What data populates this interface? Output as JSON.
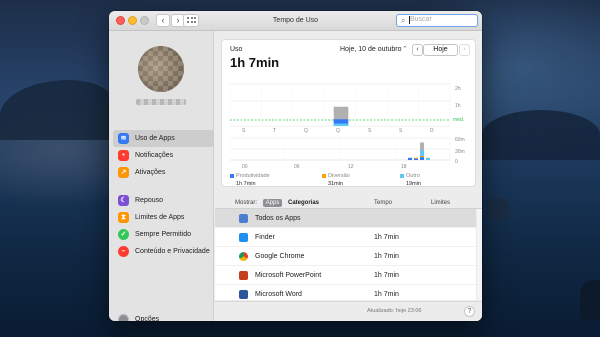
{
  "window": {
    "title": "Tempo de Uso"
  },
  "search": {
    "placeholder": "Buscar"
  },
  "sidebar": {
    "items": [
      {
        "label": "Uso de Apps",
        "icon": "layers-icon",
        "color": "#3478f6",
        "selected": true
      },
      {
        "label": "Notificações",
        "icon": "bell-icon",
        "color": "#ff3b30"
      },
      {
        "label": "Ativações",
        "icon": "pickup-icon",
        "color": "#ff9500"
      },
      {
        "label": "Repouso",
        "icon": "moon-icon",
        "color": "#7d4fd6"
      },
      {
        "label": "Limites de Apps",
        "icon": "hourglass-icon",
        "color": "#ff9500"
      },
      {
        "label": "Sempre Permitido",
        "icon": "checkmark-icon",
        "color": "#34c759"
      },
      {
        "label": "Conteúdo e Privacidade",
        "icon": "no-entry-icon",
        "color": "#ff3b30"
      }
    ],
    "options_label": "Opções"
  },
  "usage": {
    "label": "Uso",
    "total": "1h 7min",
    "date_label": "Hoje, 10 de outubro",
    "today_button": "Hoje",
    "weekly_axis": [
      "2h",
      "1h",
      "méd."
    ],
    "weekday_labels": [
      "S",
      "T",
      "Q",
      "Q",
      "S",
      "S",
      "D"
    ],
    "hourly_axis": [
      "60m",
      "30m",
      "0"
    ],
    "hour_labels": [
      "00",
      "06",
      "12",
      "18"
    ],
    "legend": [
      {
        "name": "Produtividade",
        "value": "1h 7min",
        "color": "#3478f6"
      },
      {
        "name": "Diversão",
        "value": "31min",
        "color": "#ff9f0a"
      },
      {
        "name": "Outro",
        "value": "19min",
        "color": "#5ac8fa"
      }
    ]
  },
  "chart_data": [
    {
      "type": "bar",
      "categories": [
        "S",
        "T",
        "Q",
        "Q",
        "S",
        "S",
        "D"
      ],
      "series": [
        {
          "values": [
            0,
            0,
            0,
            1.1,
            0,
            0,
            0
          ]
        }
      ],
      "ylabels": [
        "2h",
        "1h",
        "méd."
      ],
      "average_line": true
    },
    {
      "type": "bar",
      "categories": [
        "00",
        "06",
        "12",
        "18"
      ],
      "series": [
        {
          "name": "Produtividade",
          "values": [
            0,
            0,
            0,
            20
          ]
        },
        {
          "name": "Diversão",
          "values": [
            0,
            0,
            0,
            5
          ]
        },
        {
          "name": "Outro",
          "values": [
            0,
            0,
            0,
            15
          ]
        }
      ],
      "ylabels": [
        "60m",
        "30m",
        "0"
      ]
    }
  ],
  "table": {
    "show_label": "Mostrar:",
    "seg_apps": "Apps",
    "seg_categories": "Categorias",
    "col_time": "Tempo",
    "col_limits": "Limites",
    "total_row": "Todos os Apps",
    "rows": [
      {
        "name": "Finder",
        "time": "1h 7min",
        "icon": "finder-icon",
        "color": "#1e8ff0"
      },
      {
        "name": "Google Chrome",
        "time": "1h 7min",
        "icon": "chrome-icon",
        "color": "#db4437"
      },
      {
        "name": "Microsoft PowerPoint",
        "time": "1h 7min",
        "icon": "powerpoint-icon",
        "color": "#c43e1c"
      },
      {
        "name": "Microsoft Word",
        "time": "1h 7min",
        "icon": "word-icon",
        "color": "#2b579a"
      }
    ]
  },
  "footer": {
    "updated": "Atualizado: hoje 23:06",
    "help": "?"
  }
}
